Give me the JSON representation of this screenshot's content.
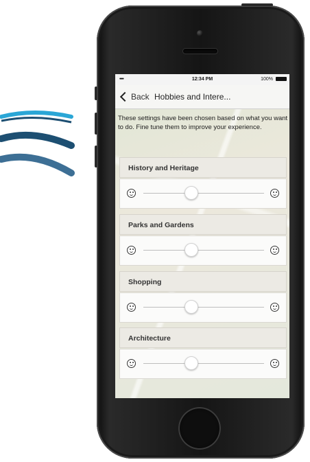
{
  "status_bar": {
    "signal": "•••• ",
    "time": "12:34 PM",
    "battery": "100%"
  },
  "nav": {
    "back_label": "Back",
    "title": "Hobbies and Intere..."
  },
  "intro_text": "These settings have been chosen based on what you want to do. Fine tune them to improve your experience.",
  "preferences": [
    {
      "label": "History and Heritage",
      "level": 0.4
    },
    {
      "label": "Parks and Gardens",
      "level": 0.4
    },
    {
      "label": "Shopping",
      "level": 0.4
    },
    {
      "label": "Architecture",
      "level": 0.4
    }
  ],
  "icons": {
    "slider_left": "sad-face-icon",
    "slider_right": "happy-face-icon"
  },
  "colors": {
    "logo_light_blue": "#2aa6d6",
    "logo_dark_blue": "#1d4f72",
    "logo_mid_blue": "#3d6f95"
  }
}
